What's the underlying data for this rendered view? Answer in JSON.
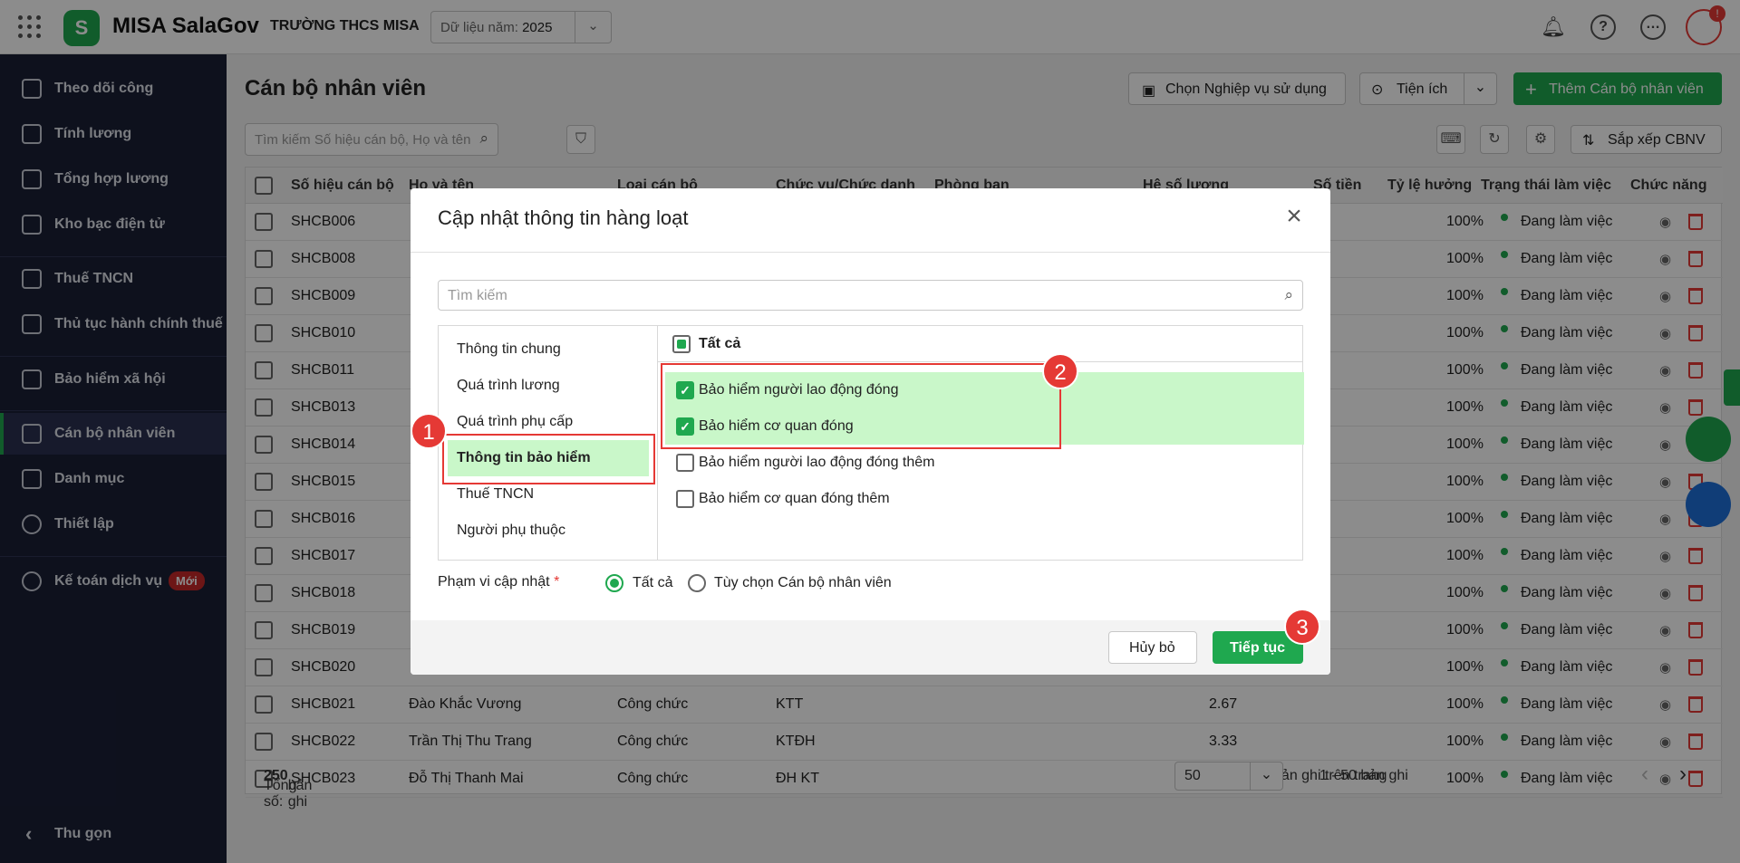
{
  "app": {
    "name": "MISA SalaGov",
    "school": "TRƯỜNG THCS MISA",
    "year_label": "Dữ liệu năm:",
    "year_value": "2025",
    "notif_badge": "!"
  },
  "sidebar": {
    "items": [
      "Theo dõi công",
      "Tính lương",
      "Tổng hợp lương",
      "Kho bạc điện tử",
      "Thuế TNCN",
      "Thủ tục hành chính thuế",
      "Bảo hiểm xã hội",
      "Cán bộ nhân viên",
      "Danh mục",
      "Thiết lập",
      "Kế toán dịch vụ"
    ],
    "new_badge": "Mới",
    "collapse": "Thu gọn",
    "active": "Cán bộ nhân viên"
  },
  "page": {
    "title": "Cán bộ nhân viên",
    "choose_btn": "Chọn Nghiệp vụ sử dụng",
    "util_btn": "Tiện ích",
    "add_btn": "Thêm Cán bộ nhân viên",
    "search_placeholder": "Tìm kiếm Số hiệu cán bộ, Họ và tên",
    "sort_btn": "Sắp xếp CBNV"
  },
  "table": {
    "headers": [
      "Số hiệu cán bộ",
      "Họ và tên",
      "Loại cán bộ",
      "Chức vụ/Chức danh",
      "Phòng ban",
      "Hệ số lương",
      "Số tiền",
      "Tỷ lệ hưởng",
      "Trạng thái làm việc",
      "Chức năng"
    ],
    "rows": [
      {
        "id": "SHCB006",
        "name": "",
        "type": "",
        "title": "",
        "coef": "",
        "rate": "100%",
        "status": "Đang làm việc"
      },
      {
        "id": "SHCB008",
        "name": "",
        "type": "",
        "title": "",
        "coef": "",
        "rate": "100%",
        "status": "Đang làm việc"
      },
      {
        "id": "SHCB009",
        "name": "",
        "type": "",
        "title": "",
        "coef": "",
        "rate": "100%",
        "status": "Đang làm việc"
      },
      {
        "id": "SHCB010",
        "name": "",
        "type": "",
        "title": "",
        "coef": "",
        "rate": "100%",
        "status": "Đang làm việc"
      },
      {
        "id": "SHCB011",
        "name": "",
        "type": "",
        "title": "",
        "coef": "",
        "rate": "100%",
        "status": "Đang làm việc"
      },
      {
        "id": "SHCB013",
        "name": "",
        "type": "",
        "title": "",
        "coef": "",
        "rate": "100%",
        "status": "Đang làm việc"
      },
      {
        "id": "SHCB014",
        "name": "",
        "type": "",
        "title": "",
        "coef": "",
        "rate": "100%",
        "status": "Đang làm việc"
      },
      {
        "id": "SHCB015",
        "name": "",
        "type": "",
        "title": "",
        "coef": "",
        "rate": "100%",
        "status": "Đang làm việc"
      },
      {
        "id": "SHCB016",
        "name": "",
        "type": "",
        "title": "",
        "coef": "",
        "rate": "100%",
        "status": "Đang làm việc"
      },
      {
        "id": "SHCB017",
        "name": "",
        "type": "",
        "title": "",
        "coef": "",
        "rate": "100%",
        "status": "Đang làm việc"
      },
      {
        "id": "SHCB018",
        "name": "",
        "type": "",
        "title": "",
        "coef": "",
        "rate": "100%",
        "status": "Đang làm việc"
      },
      {
        "id": "SHCB019",
        "name": "",
        "type": "",
        "title": "",
        "coef": "",
        "rate": "100%",
        "status": "Đang làm việc"
      },
      {
        "id": "SHCB020",
        "name": "",
        "type": "",
        "title": "",
        "coef": "",
        "rate": "100%",
        "status": "Đang làm việc"
      },
      {
        "id": "SHCB021",
        "name": "Đào Khắc Vương",
        "type": "Công chức",
        "title": "KTT",
        "coef": "2.67",
        "rate": "100%",
        "status": "Đang làm việc"
      },
      {
        "id": "SHCB022",
        "name": "Trần Thị Thu Trang",
        "type": "Công chức",
        "title": "KTĐH",
        "coef": "3.33",
        "rate": "100%",
        "status": "Đang làm việc"
      },
      {
        "id": "SHCB023",
        "name": "Đỗ Thị Thanh Mai",
        "type": "Công chức",
        "title": "ĐH KT",
        "coef": "2.67",
        "rate": "100%",
        "status": "Đang làm việc"
      }
    ],
    "total_label": "Tổng số:",
    "total_value": "250",
    "total_suffix": "bản ghi",
    "per_page_label": "Số bản ghi trên trang",
    "per_page": "50",
    "range": "1 - 50 bản ghi"
  },
  "dialog": {
    "title": "Cập nhật thông tin hàng loạt",
    "search_placeholder": "Tìm kiếm",
    "groups": [
      "Thông tin chung",
      "Quá trình lương",
      "Quá trình phụ cấp",
      "Thông tin bảo hiểm",
      "Thuế TNCN",
      "Người phụ thuộc"
    ],
    "select_all": "Tất cả",
    "options": [
      {
        "label": "Bảo hiểm người lao động đóng",
        "checked": true
      },
      {
        "label": "Bảo hiểm cơ quan đóng",
        "checked": true
      },
      {
        "label": "Bảo hiểm người lao động đóng thêm",
        "checked": false
      },
      {
        "label": "Bảo hiểm cơ quan đóng thêm",
        "checked": false
      }
    ],
    "scope_label": "Phạm vi cập nhật",
    "required": "*",
    "scope_all": "Tất cả",
    "scope_custom": "Tùy chọn Cán bộ nhân viên",
    "cancel": "Hủy bỏ",
    "continue": "Tiếp tục"
  },
  "steps": [
    "1",
    "2",
    "3"
  ],
  "colors": {
    "accent": "#1fa84f",
    "highlight": "#c9f7c9",
    "danger": "#e53935",
    "sidebar": "#1a1f36"
  }
}
